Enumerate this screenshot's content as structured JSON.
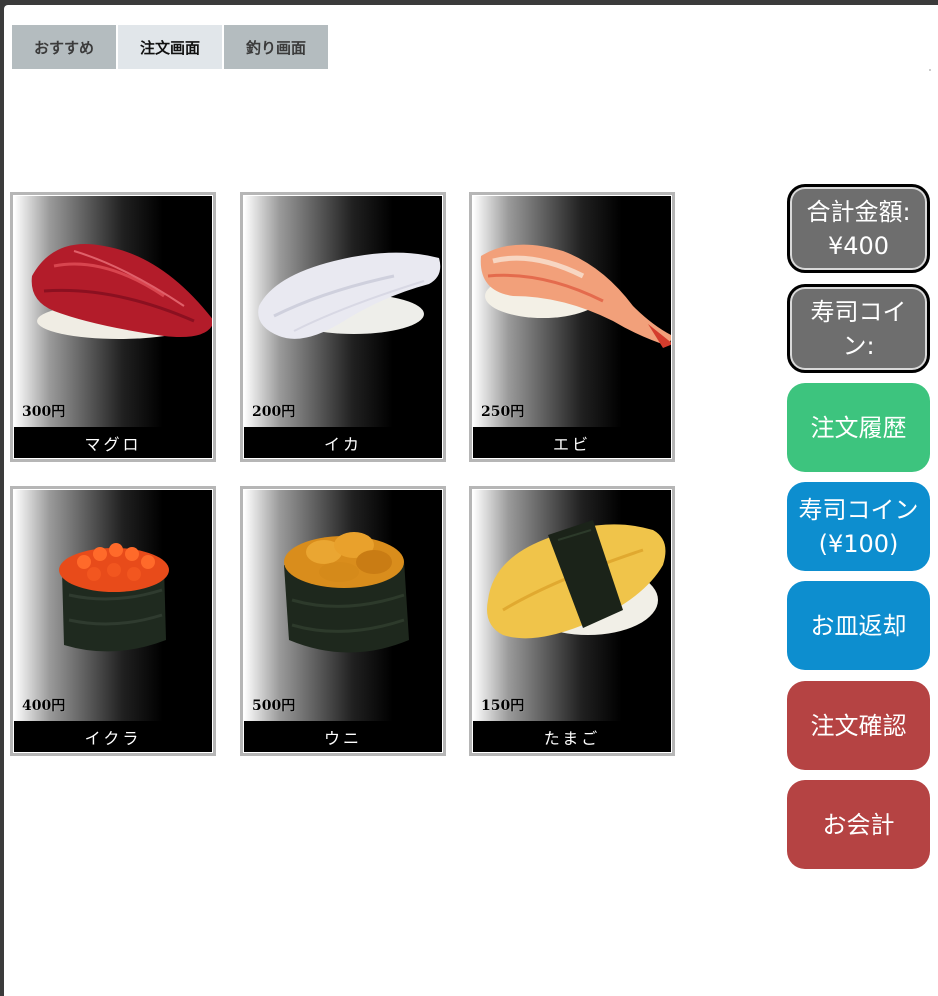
{
  "tabs": [
    {
      "label": "おすすめ",
      "active": false
    },
    {
      "label": "注文画面",
      "active": true
    },
    {
      "label": "釣り画面",
      "active": false
    }
  ],
  "items": [
    {
      "name": "マグロ",
      "price": "300円",
      "icon": "tuna-nigiri-image"
    },
    {
      "name": "イカ",
      "price": "200円",
      "icon": "squid-nigiri-image"
    },
    {
      "name": "エビ",
      "price": "250円",
      "icon": "shrimp-nigiri-image"
    },
    {
      "name": "イクラ",
      "price": "400円",
      "icon": "ikura-gunkan-image"
    },
    {
      "name": "ウニ",
      "price": "500円",
      "icon": "uni-gunkan-image"
    },
    {
      "name": "たまご",
      "price": "150円",
      "icon": "tamago-nigiri-image"
    }
  ],
  "sidebar": {
    "total_label": "合計金額:",
    "total_value": "¥400",
    "coin_label_1": "寿司コイ",
    "coin_label_2": "ン:",
    "history": "注文履歴",
    "coin_buy_1": "寿司コイン",
    "coin_buy_2": "(¥100)",
    "plate_return": "お皿返却",
    "order_confirm": "注文確認",
    "checkout": "お会計"
  },
  "colors": {
    "tab_inactive": "#b4bcbf",
    "tab_active": "#e1e6ea",
    "gray_button": "#6e6e6e",
    "green_button": "#3dc47e",
    "blue_button": "#0d8ecf",
    "red_button": "#b54343"
  }
}
